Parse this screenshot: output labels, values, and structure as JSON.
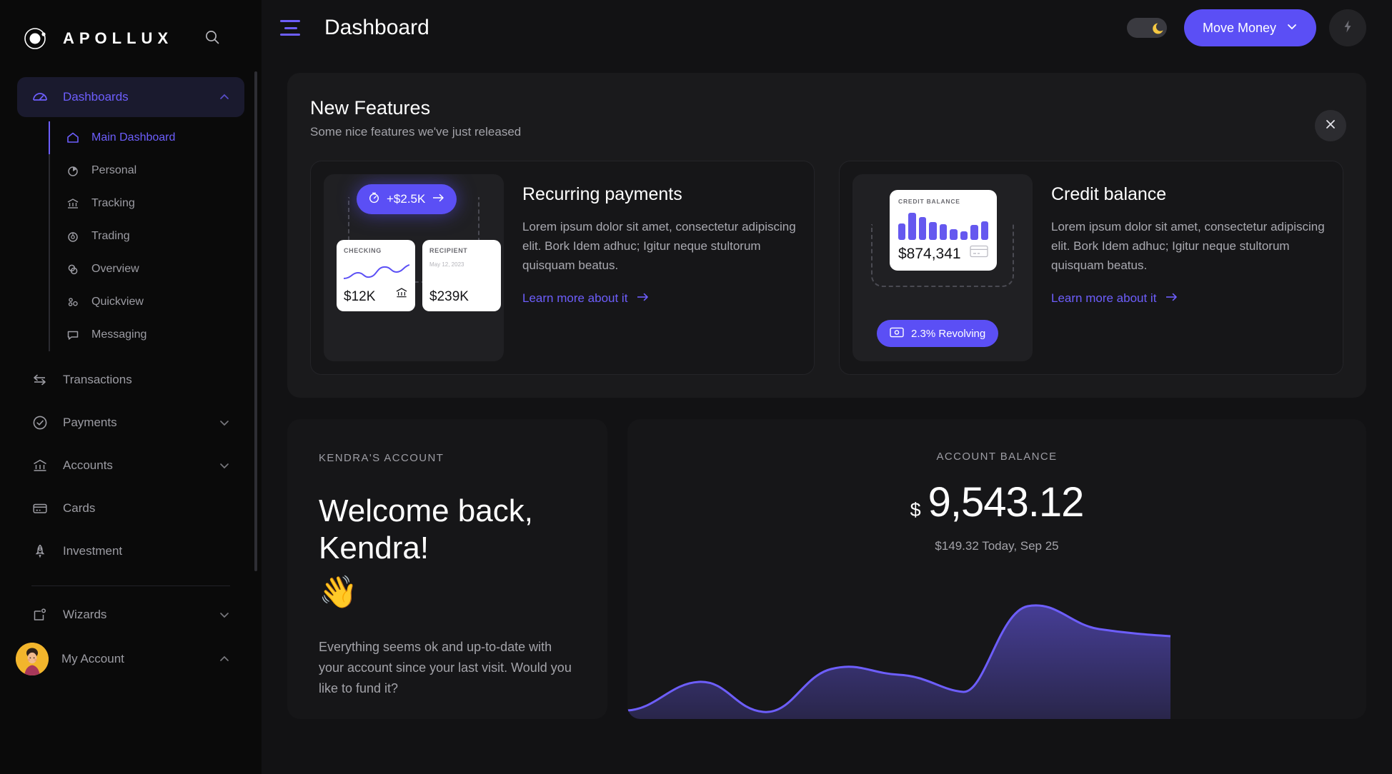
{
  "brand": {
    "name": "APOLLUX",
    "logo_icon": "orbit-icon",
    "search_icon": "search-icon"
  },
  "sidebar": {
    "group": {
      "label": "Dashboards",
      "icon": "gauge-icon",
      "expanded_icon": "chevron-up-icon",
      "items": [
        {
          "label": "Main Dashboard",
          "icon": "home-icon",
          "active": true
        },
        {
          "label": "Personal",
          "icon": "pie-chart-icon",
          "active": false
        },
        {
          "label": "Tracking",
          "icon": "bank-icon",
          "active": false
        },
        {
          "label": "Trading",
          "icon": "donut-chart-icon",
          "active": false
        },
        {
          "label": "Overview",
          "icon": "circles-icon",
          "active": false
        },
        {
          "label": "Quickview",
          "icon": "dots-icon",
          "active": false
        },
        {
          "label": "Messaging",
          "icon": "message-icon",
          "active": false
        }
      ]
    },
    "items": [
      {
        "label": "Transactions",
        "icon": "transfer-arrows-icon",
        "chevron": ""
      },
      {
        "label": "Payments",
        "icon": "check-circle-icon",
        "chevron": "chevron-down-icon"
      },
      {
        "label": "Accounts",
        "icon": "bank-icon",
        "chevron": "chevron-down-icon"
      },
      {
        "label": "Cards",
        "icon": "credit-card-icon",
        "chevron": ""
      },
      {
        "label": "Investment",
        "icon": "rocket-icon",
        "chevron": ""
      }
    ],
    "footer_items": [
      {
        "label": "Wizards",
        "icon": "wizard-square-icon",
        "chevron": "chevron-down-icon"
      }
    ],
    "account": {
      "label": "My Account",
      "avatar_icon": "user-avatar",
      "chevron": "chevron-up-icon"
    }
  },
  "topbar": {
    "menu_icon": "hamburger-icon",
    "title": "Dashboard",
    "theme_toggle_icon": "moon-icon",
    "move_money_label": "Move Money",
    "move_money_chevron": "chevron-down-icon",
    "bolt_icon": "lightning-bolt-icon"
  },
  "features": {
    "title": "New Features",
    "subtitle": "Some nice features we've just released",
    "close_icon": "close-icon",
    "cards": [
      {
        "title": "Recurring payments",
        "text": "Lorem ipsum dolor sit amet, consectetur adipiscing elit. Bork Idem adhuc; Igitur neque stultorum quisquam beatus.",
        "link": "Learn more about it",
        "link_icon": "arrow-right-icon",
        "visual": {
          "pill_icon": "stopwatch-icon",
          "pill_value": "+$2.5K",
          "pill_arrow": "arrow-right-icon",
          "card_left": {
            "label": "CHECKING",
            "amount": "$12K",
            "icon": "bank-icon"
          },
          "card_right": {
            "label": "RECIPIENT",
            "date": "May 12, 2023",
            "amount": "$239K"
          }
        }
      },
      {
        "title": "Credit balance",
        "text": "Lorem ipsum dolor sit amet, consectetur adipiscing elit. Bork Idem adhuc; Igitur neque stultorum quisquam beatus.",
        "link": "Learn more about it",
        "link_icon": "arrow-right-icon",
        "visual": {
          "card_label": "CREDIT BALANCE",
          "amount": "$874,341",
          "card_icon": "credit-card-icon",
          "pill_icon": "money-icon",
          "pill_label": "2.3% Revolving"
        }
      }
    ]
  },
  "welcome": {
    "eyebrow": "KENDRA'S ACCOUNT",
    "heading": "Welcome back, Kendra!",
    "wave_emoji": "👋",
    "body": "Everything seems ok and up-to-date with your account since your last visit. Would you like to fund it?"
  },
  "balance": {
    "eyebrow": "ACCOUNT BALANCE",
    "currency": "$",
    "value": "9,543.12",
    "subtext": "$149.32 Today, Sep 25"
  },
  "colors": {
    "accent": "#5b4ff5",
    "accent_light": "#6d5efc",
    "bg": "#121214",
    "sidebar_bg": "#0a0a0a",
    "card_bg": "#161618",
    "panel_bg": "#1a1a1c",
    "avatar_yellow": "#f2b52c",
    "moon_yellow": "#f5c842"
  },
  "chart_data": {
    "type": "area",
    "title": "",
    "xlabel": "",
    "ylabel": "",
    "x": [
      0,
      1,
      2,
      3,
      4,
      5,
      6,
      7,
      8,
      9,
      10
    ],
    "values": [
      4,
      12,
      22,
      10,
      3,
      20,
      32,
      30,
      24,
      78,
      70
    ],
    "ylim": [
      0,
      100
    ],
    "grid": false,
    "legend": "none",
    "line_color": "#6d5efc",
    "fill_color": "#6d5efc"
  },
  "credit_bars": [
    58,
    95,
    80,
    62,
    55,
    38,
    30,
    52,
    66
  ]
}
